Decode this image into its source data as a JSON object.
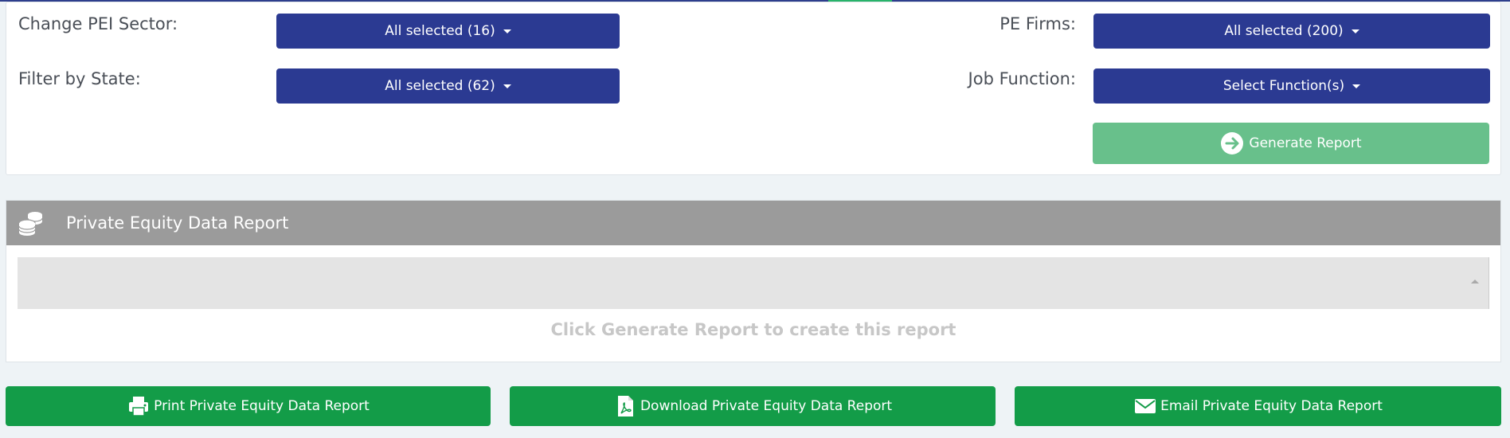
{
  "filters": {
    "sector_label": "Change PEI Sector:",
    "sector_value": "All selected (16)",
    "state_label": "Filter by State:",
    "state_value": "All selected (62)",
    "firms_label": "PE Firms:",
    "firms_value": "All selected (200)",
    "job_label": "Job Function:",
    "job_value": "Select Function(s)",
    "generate_label": "Generate Report"
  },
  "report": {
    "title": "Private Equity Data Report",
    "empty_message": "Click Generate Report to create this report"
  },
  "actions": {
    "print_label": "Print Private Equity Data Report",
    "download_label": "Download Private Equity Data Report",
    "email_label": "Email Private Equity Data Report"
  },
  "colors": {
    "dropdown_bg": "#2b3a92",
    "generate_bg": "#68c08b",
    "action_bg": "#139c48",
    "report_header_bg": "#9b9b9b"
  },
  "icons": {
    "generate": "arrow-right-circle-icon",
    "report": "coins-icon",
    "print": "printer-icon",
    "download": "pdf-file-icon",
    "email": "envelope-icon"
  }
}
